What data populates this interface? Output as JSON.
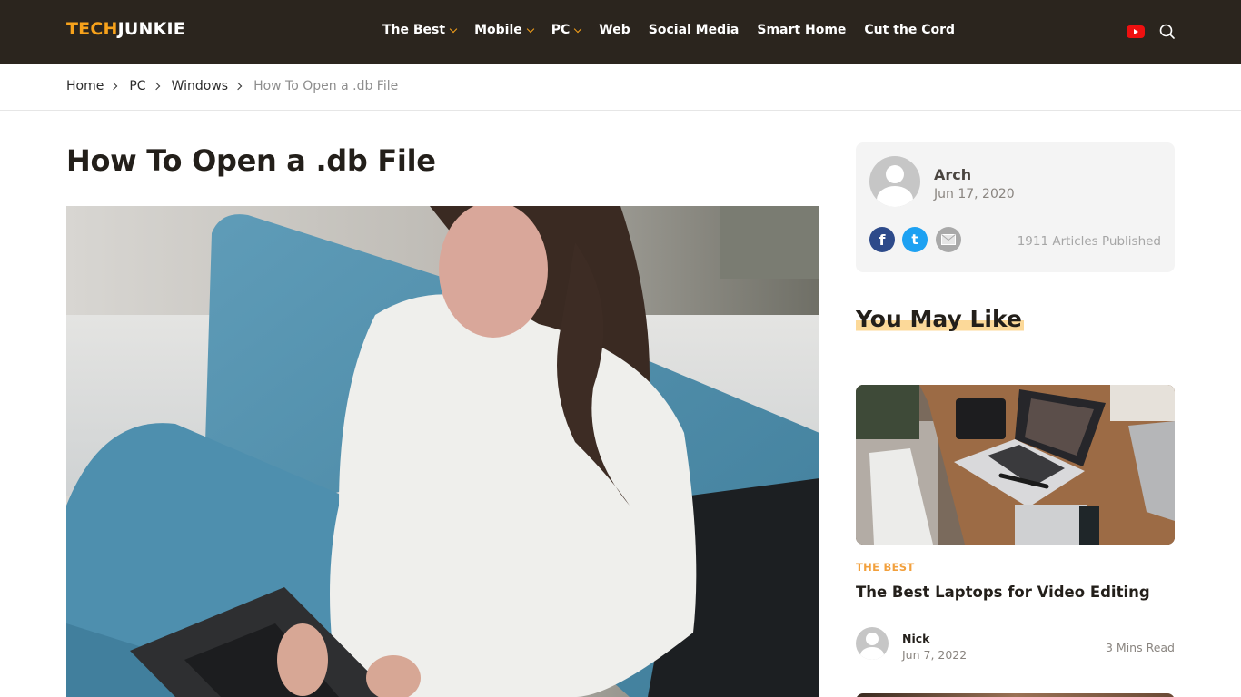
{
  "header": {
    "logo": {
      "part1": "TECH",
      "part2": "JUNKIE"
    },
    "nav": [
      {
        "label": "The Best",
        "has_dropdown": true
      },
      {
        "label": "Mobile",
        "has_dropdown": true
      },
      {
        "label": "PC",
        "has_dropdown": true
      },
      {
        "label": "Web",
        "has_dropdown": false
      },
      {
        "label": "Social Media",
        "has_dropdown": false
      },
      {
        "label": "Smart Home",
        "has_dropdown": false
      },
      {
        "label": "Cut the Cord",
        "has_dropdown": false
      }
    ],
    "icons": [
      "youtube-icon",
      "search-icon"
    ]
  },
  "breadcrumb": {
    "items": [
      "Home",
      "PC",
      "Windows"
    ],
    "current": "How To Open a .db File"
  },
  "article": {
    "title": "How To Open a .db File",
    "hero_image": "woman-typing-on-laptop-on-blue-sofa"
  },
  "author_card": {
    "name": "Arch",
    "date": "Jun 17, 2020",
    "social": [
      "facebook-icon",
      "twitter-icon",
      "email-icon"
    ],
    "articles_published": "1911 Articles Published"
  },
  "sidebar": {
    "section_title": "You May Like",
    "cards": [
      {
        "image": "laptop-video-editing-desk",
        "category": "THE BEST",
        "title": "The Best Laptops for Video Editing",
        "author": "Nick",
        "date": "Jun 7, 2022",
        "read_time": "3 Mins Read"
      }
    ]
  },
  "colors": {
    "header_bg": "#2b251e",
    "accent": "#f7a21b",
    "highlight": "#fcd999",
    "category": "#f2a03d",
    "facebook": "#2d4a8a",
    "twitter": "#1da1f2",
    "youtube": "#ee1010"
  }
}
